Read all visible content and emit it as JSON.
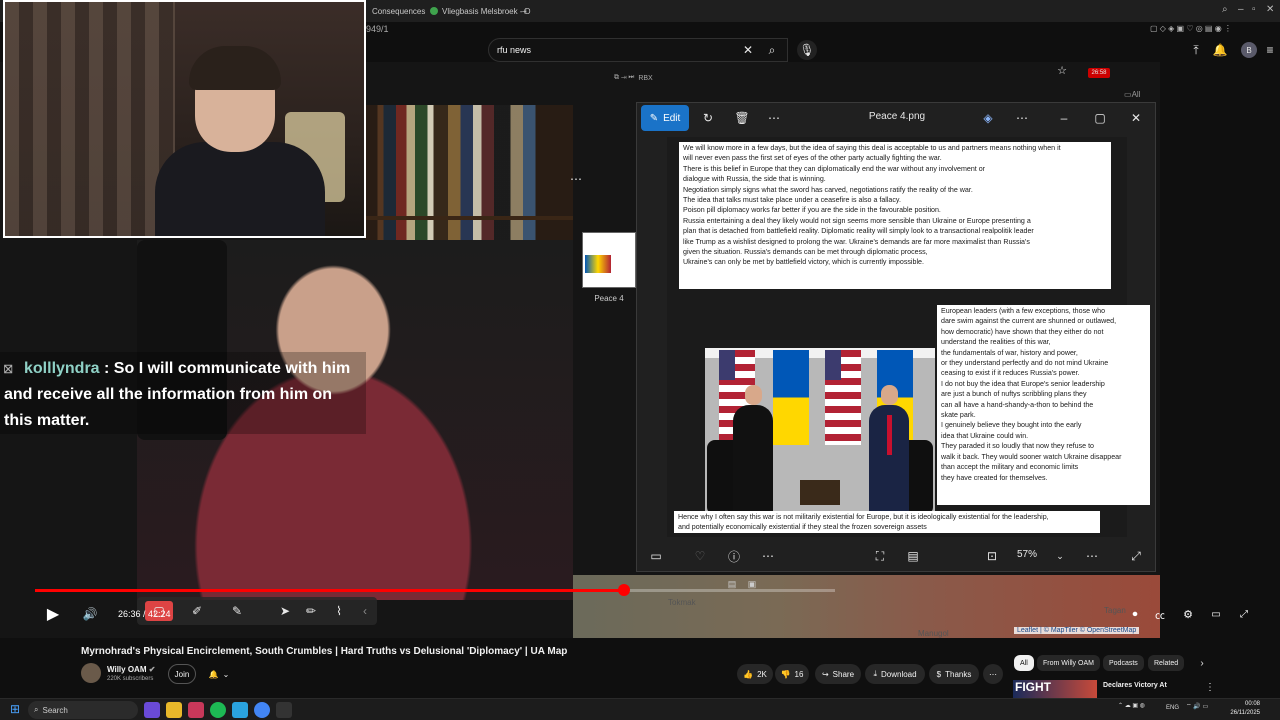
{
  "browser": {
    "tabs": [
      {
        "label": "Consequences"
      },
      {
        "label": "Vliegbasis Melsbroek - D"
      }
    ],
    "new_tab": "+",
    "search_query": "rfu news",
    "url_fragment": "949/1",
    "rbx": "RBX",
    "badge_time": "26:58",
    "avatar_letter": "B",
    "all_label": "All"
  },
  "chat": {
    "username": "kolllyndra",
    "message_line1": ": So I will communicate with him",
    "message_line2": "and receive all the information from him on",
    "message_line3": "this matter."
  },
  "photos_app": {
    "edit_label": "Edit",
    "title": "Peace 4.png",
    "zoom": "57%",
    "filmstrip_label": "Peace 4",
    "doc": {
      "block1": [
        "We will know more in a few days, but the idea of saying this deal is acceptable to us and partners means nothing when it",
        "will never even pass the first set of eyes of the other party actually fighting the war.",
        "There is this belief in Europe that they can diplomatically end the war without any involvement or",
        "dialogue with Russia, the side that is winning.",
        "",
        "Negotiation simply signs what the sword has carved, negotiations ratify the reality of the war.",
        "The idea that talks must take place under a ceasefire is also a fallacy.",
        "",
        "Poison pill diplomacy works far better if you are the side in the favourable position.",
        "Russia entertaining a deal they likely would not sign seems more sensible than Ukraine or Europe presenting a",
        "plan that is detached from battlefield reality. Diplomatic reality will simply look to a transactional realpolitik leader",
        "like Trump as a wishlist designed to prolong the war. Ukraine's demands are far more maximalist than Russia's",
        "given the situation. Russia's demands can be met through diplomatic process,",
        "Ukraine's can only be met by battlefield victory, which is currently impossible."
      ],
      "block2": [
        "European leaders (with a few exceptions, those who",
        "dare swim against the current are shunned or outlawed,",
        "how democratic) have shown that they either do not",
        "understand the realities of this war,",
        "the fundamentals of war, history and power,",
        "or they understand perfectly and do not mind Ukraine",
        "ceasing to exist if it reduces Russia's power.",
        "",
        "I do not buy the idea that Europe's senior leadership",
        "are just a bunch of nuftys scribbling plans they",
        "can all have a hand-shandy-a-thon to behind the",
        "skate park.",
        "",
        "I genuinely believe they bought into the early",
        "idea that Ukraine could win.",
        "They paraded it so loudly that now they refuse to",
        "walk it back. They would sooner watch Ukraine disappear",
        "than accept the military and economic limits",
        "they have created for themselves."
      ],
      "block3": [
        "Hence why I often say this war is not militarily existential for Europe, but it is ideologically existential for the leadership,",
        "and potentially economically existential if they steal the frozen sovereign assets"
      ]
    }
  },
  "player": {
    "time": "26:36 / 42:24",
    "progress": 0.7363,
    "map_attribution": "Leaflet | © MapTiler © OpenStreetMap",
    "map_labels": [
      "Tokmak",
      "Manugol",
      "Tagan"
    ]
  },
  "video_info": {
    "title": "Myrnohrad's Physical Encirclement, South Crumbles | Hard Truths vs Delusional 'Diplomacy' | UA Map",
    "channel": "Willy OAM",
    "subscribers": "220K subscribers",
    "join": "Join",
    "likes": "2K",
    "dislikes": "16",
    "share": "Share",
    "download": "Download",
    "thanks": "Thanks"
  },
  "related_chips": [
    "All",
    "From Willy OAM",
    "Podcasts",
    "Related"
  ],
  "recommendation": {
    "thumb_text": "FIGHT",
    "title": "Declares Victory At"
  },
  "taskbar": {
    "search": "Search",
    "lang": "ENG",
    "time": "00:08",
    "date": "26/11/2025"
  },
  "colors": {
    "accent": "#1a73c8",
    "progress": "#ff0000",
    "chat_user": "#8fd1c6"
  }
}
